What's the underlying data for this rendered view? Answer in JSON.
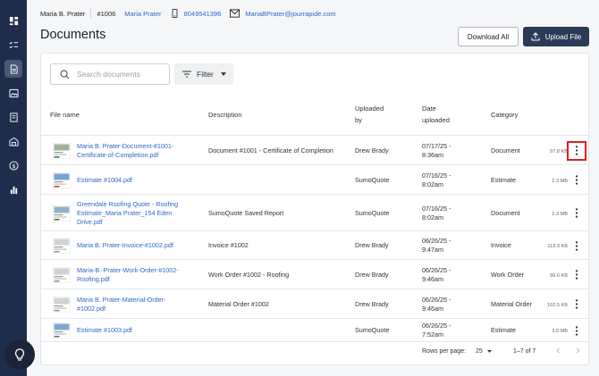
{
  "contact": {
    "name": "Maria B. Prater",
    "job_number": "#1006",
    "first_name_link": "Maria Prater",
    "phone": "8049541396",
    "email": "MariaBPrater@jourrapide.com"
  },
  "page": {
    "title": "Documents",
    "download_all_label": "Download All",
    "upload_label": "Upload File"
  },
  "toolbar": {
    "search_placeholder": "Search documents",
    "filter_label": "Filter"
  },
  "table": {
    "headers": {
      "file_name": "File name",
      "description": "Description",
      "uploaded_by_1": "Uploaded",
      "uploaded_by_2": "by",
      "date_1": "Date",
      "date_2": "uploaded",
      "category": "Category"
    },
    "rows": [
      {
        "name1": "Maria B. Prater-Document-#1001-",
        "name2": "Certificate-of-Completion.pdf",
        "name3": "",
        "description": "Document #1001 - Certificate of Completion",
        "uploaded_by": "Drew Brady",
        "date1": "07/17/25 -",
        "date2": "8:36am",
        "category": "Document",
        "size": "97.8 KB"
      },
      {
        "name1": "Estimate #1004.pdf",
        "name2": "",
        "name3": "",
        "description": "",
        "uploaded_by": "SumoQuote",
        "date1": "07/16/25 -",
        "date2": "8:02am",
        "category": "Estimate",
        "size": "2.3 MB"
      },
      {
        "name1": "Greendale Roofing Quote - Roofing",
        "name2": "Estimate_Maria Prater_154 Eden",
        "name3": "Drive.pdf",
        "description": "SumoQuote Saved Report",
        "uploaded_by": "SumoQuote",
        "date1": "07/16/25 -",
        "date2": "8:02am",
        "category": "Document",
        "size": "2.3 MB"
      },
      {
        "name1": "Maria B. Prater-Invoice-#1002.pdf",
        "name2": "",
        "name3": "",
        "description": "Invoice #1002",
        "uploaded_by": "Drew Brady",
        "date1": "06/26/25 -",
        "date2": "9:47am",
        "category": "Invoice",
        "size": "113.3 KB"
      },
      {
        "name1": "Maria-B.-Prater-Work-Order-#1002-",
        "name2": "Roofing.pdf",
        "name3": "",
        "description": "Work Order #1002 - Roofing",
        "uploaded_by": "Drew Brady",
        "date1": "06/26/25 -",
        "date2": "9:46am",
        "category": "Work Order",
        "size": "99.6 KB"
      },
      {
        "name1": "Maria B. Prater-Material-Order-",
        "name2": "#1002.pdf",
        "name3": "",
        "description": "Material Order #1002",
        "uploaded_by": "Drew Brady",
        "date1": "06/26/25 -",
        "date2": "9:46am",
        "category": "Material Order",
        "size": "102.5 KB"
      },
      {
        "name1": "Estimate #1003.pdf",
        "name2": "",
        "name3": "",
        "description": "",
        "uploaded_by": "SumoQuote",
        "date1": "06/26/25 -",
        "date2": "7:52am",
        "category": "Estimate",
        "size": "3.0 MB"
      }
    ]
  },
  "pagination": {
    "rows_per_page_label": "Rows per page:",
    "rows_per_page_value": "25",
    "range": "1–7 of 7"
  },
  "colors": {
    "sidebar": "#1f2d4d",
    "accent_link": "#2f67c8",
    "primary_button": "#2b3a59",
    "highlight": "#e01f1f"
  }
}
